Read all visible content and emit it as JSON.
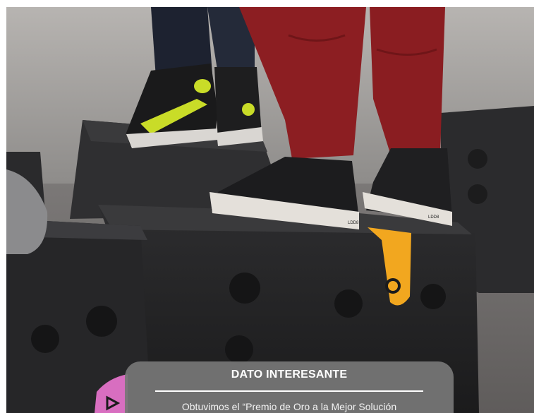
{
  "info_card": {
    "title": "DATO INTERESANTE",
    "body": "Obtuvimos el “Premio de Oro a la Mejor Solución"
  },
  "photo": {
    "shoe_brand_label": "LDD8",
    "colors": {
      "accent_yellow": "#f2a71f",
      "accent_pink": "#d86ec0",
      "box_black": "#2a2a2c",
      "jeans_red": "#8c1e22",
      "card_gray": "#767676"
    }
  }
}
